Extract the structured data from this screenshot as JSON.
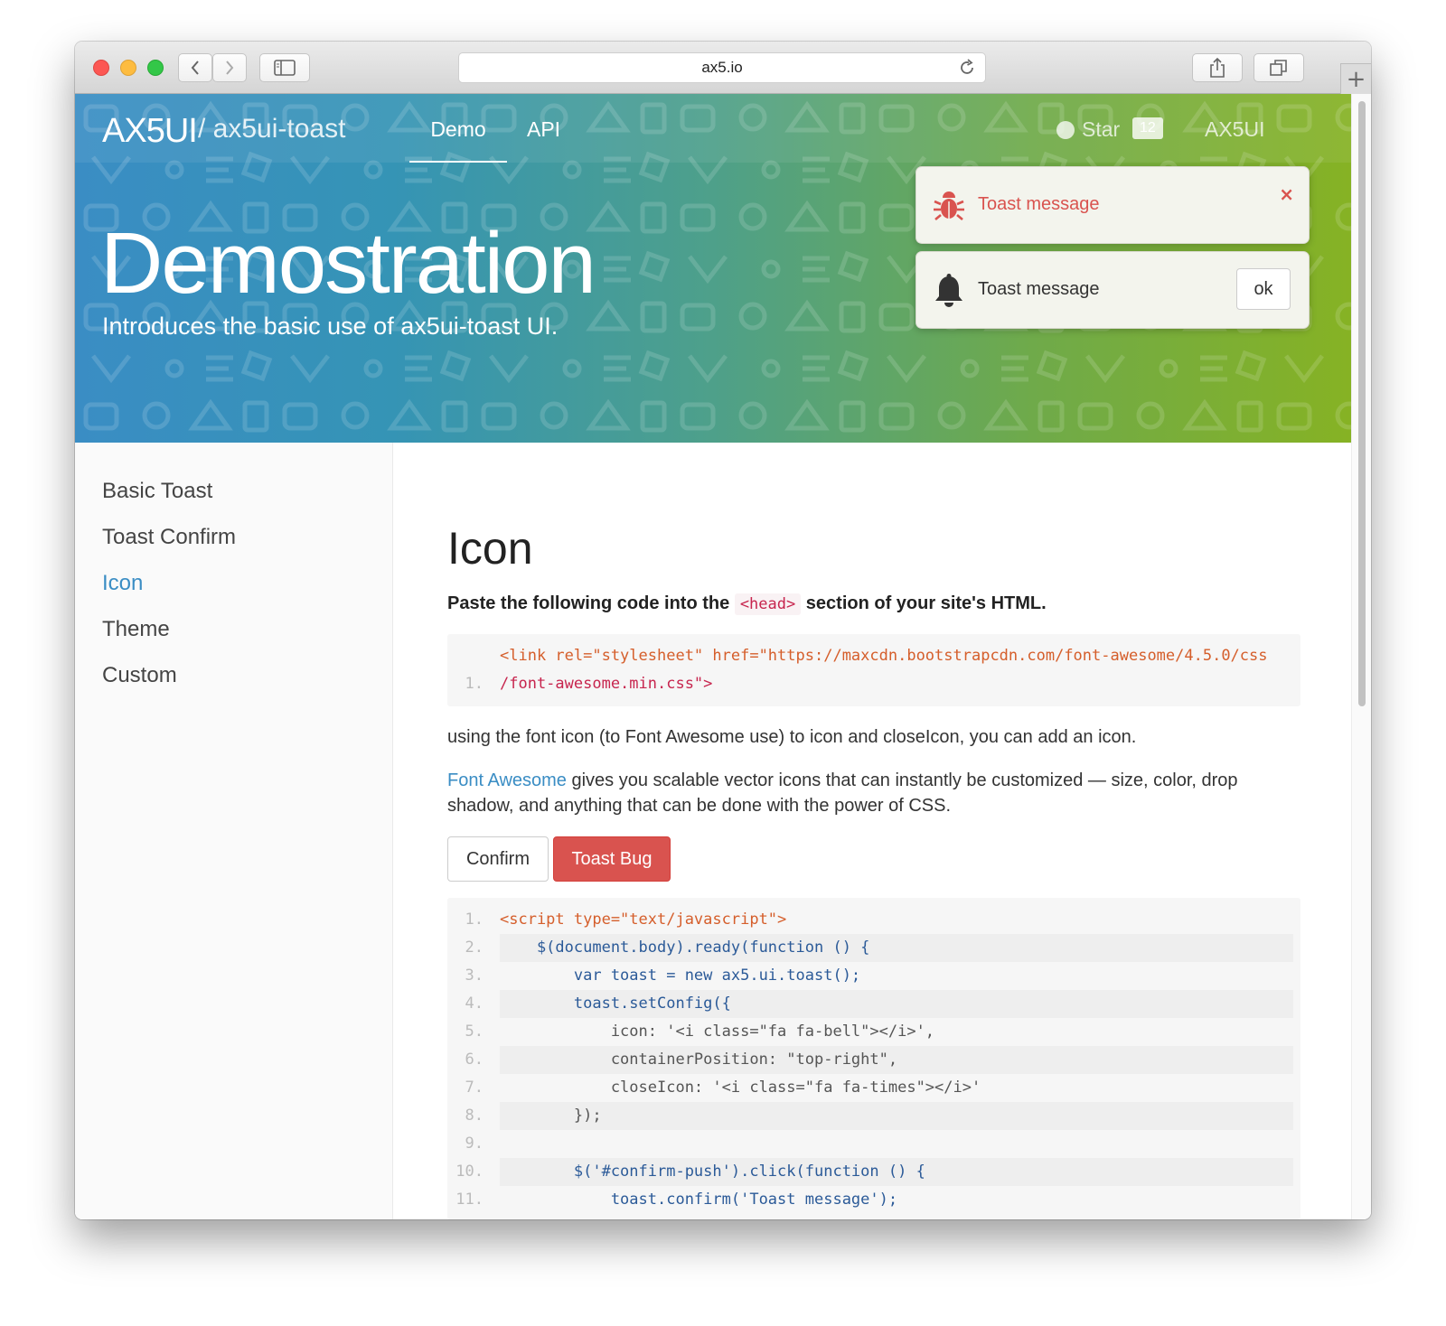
{
  "browser": {
    "url": "ax5.io",
    "new_tab_label": "+"
  },
  "header": {
    "logo": "AX5UI",
    "repo": "/ ax5ui-toast",
    "nav": [
      {
        "label": "Demo",
        "active": true
      },
      {
        "label": "API",
        "active": false
      }
    ],
    "star_label": "Star",
    "star_count": "12",
    "menu_label": "AX5UI"
  },
  "hero": {
    "title": "Demostration",
    "subtitle": "Introduces the basic use of ax5ui-toast UI."
  },
  "sidebar": {
    "items": [
      {
        "label": "Basic Toast",
        "active": false
      },
      {
        "label": "Toast Confirm",
        "active": false
      },
      {
        "label": "Icon",
        "active": true
      },
      {
        "label": "Theme",
        "active": false
      },
      {
        "label": "Custom",
        "active": false
      }
    ]
  },
  "content": {
    "title": "Icon",
    "lead_before": "Paste the following code into the",
    "lead_code": "<head>",
    "lead_after": "section of your site's HTML.",
    "head_snippet": {
      "line1_no": "1.",
      "line1": "<link rel=\"stylesheet\" href=\"https://maxcdn.bootstrapcdn.com/font-awesome/4.5.0/css",
      "line1_cont": "/font-awesome.min.css\">"
    },
    "para1": "using the font icon (to Font Awesome use) to icon and closeIcon, you can add an icon.",
    "para2_link": "Font Awesome",
    "para2_rest": " gives you scalable vector icons that can instantly be customized — size, color, drop shadow, and anything that can be done with the power of CSS.",
    "buttons": {
      "confirm": "Confirm",
      "toast_bug": "Toast Bug"
    },
    "code_lines": [
      {
        "no": "1.",
        "text": "<script type=\"text/javascript\">"
      },
      {
        "no": "2.",
        "text": "    $(document.body).ready(function () {"
      },
      {
        "no": "3.",
        "text": "        var toast = new ax5.ui.toast();"
      },
      {
        "no": "4.",
        "text": "        toast.setConfig({"
      },
      {
        "no": "5.",
        "text": "            icon: '<i class=\"fa fa-bell\"></i>',"
      },
      {
        "no": "6.",
        "text": "            containerPosition: \"top-right\","
      },
      {
        "no": "7.",
        "text": "            closeIcon: '<i class=\"fa fa-times\"></i>'"
      },
      {
        "no": "8.",
        "text": "        });"
      },
      {
        "no": "9.",
        "text": ""
      },
      {
        "no": "10.",
        "text": "        $('#confirm-push').click(function () {"
      },
      {
        "no": "11.",
        "text": "            toast.confirm('Toast message');"
      }
    ]
  },
  "toasts": [
    {
      "message": "Toast message",
      "icon": "bug-icon",
      "action": "×",
      "theme": "danger"
    },
    {
      "message": "Toast message",
      "icon": "bell-icon",
      "action": "ok",
      "theme": "default"
    }
  ],
  "colors": {
    "accent": "#3a8dc4",
    "danger": "#d9534f",
    "hero_left": "#3a8dc4",
    "hero_right": "#86b224"
  }
}
